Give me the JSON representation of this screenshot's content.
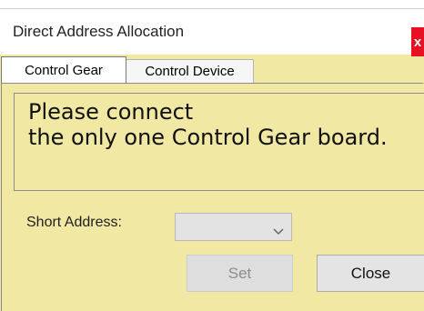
{
  "window": {
    "title": "Direct Address Allocation",
    "close_glyph": "x"
  },
  "tabs": [
    {
      "label": "Control Gear",
      "active": true
    },
    {
      "label": "Control Device",
      "active": false
    }
  ],
  "message": {
    "line1": "Please connect",
    "line2": "the only one Control Gear board."
  },
  "short_address": {
    "label": "Short Address:",
    "value": "",
    "enabled": false
  },
  "buttons": {
    "set": "Set",
    "close": "Close"
  },
  "colors": {
    "background": "#f1e8a3",
    "close_accent": "#e81123"
  },
  "icons": {
    "close": "close-icon",
    "dropdown": "chevron-down-icon"
  }
}
